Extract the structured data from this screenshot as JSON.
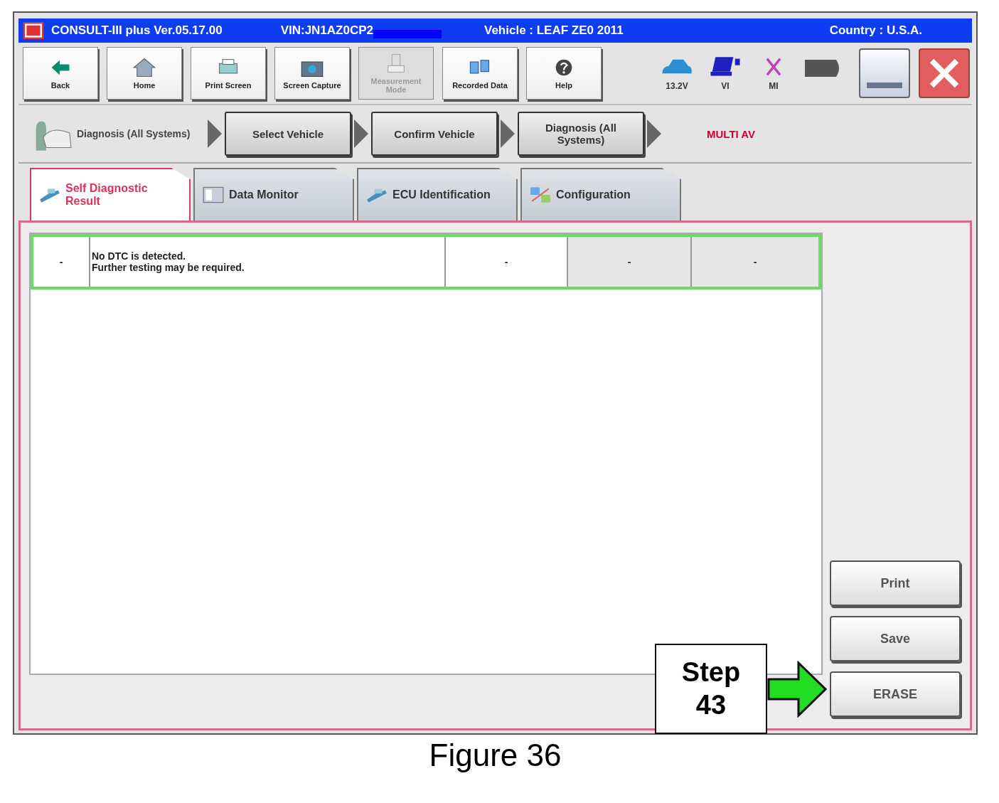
{
  "window": {
    "title": "CONSULT-III plus  Ver.05.17.00",
    "vin": "VIN:JN1AZ0CP2",
    "vehicle": "Vehicle : LEAF ZE0 2011",
    "country": "Country : U.S.A."
  },
  "toolbar": [
    {
      "label": "Back",
      "disabled": false
    },
    {
      "label": "Home",
      "disabled": false
    },
    {
      "label": "Print Screen",
      "disabled": false
    },
    {
      "label": "Screen Capture",
      "disabled": false
    },
    {
      "label": "Measurement Mode",
      "disabled": true
    },
    {
      "label": "Recorded Data",
      "disabled": false
    },
    {
      "label": "Help",
      "disabled": false
    }
  ],
  "status": [
    {
      "kind": "battery",
      "label": "13.2V"
    },
    {
      "kind": "vi",
      "label": "VI"
    },
    {
      "kind": "mi",
      "label": "MI"
    }
  ],
  "breadcrumb": {
    "label": "Diagnosis (All Systems)",
    "steps": [
      "Select Vehicle",
      "Confirm Vehicle",
      "Diagnosis (All Systems)"
    ],
    "system": "MULTI AV"
  },
  "tabs": [
    {
      "label": "Self Diagnostic Result",
      "selected": true
    },
    {
      "label": "Data Monitor",
      "selected": false
    },
    {
      "label": "ECU Identification",
      "selected": false
    },
    {
      "label": "Configuration",
      "selected": false
    }
  ],
  "table": {
    "rows": [
      {
        "selected": true,
        "cells": [
          "-",
          "No DTC is detected.\nFurther testing may be required.",
          "-",
          "-",
          "-"
        ]
      }
    ]
  },
  "side_buttons": [
    "Print",
    "Save",
    "ERASE"
  ],
  "callout": {
    "text": "Step 43"
  },
  "caption": "Figure 36"
}
